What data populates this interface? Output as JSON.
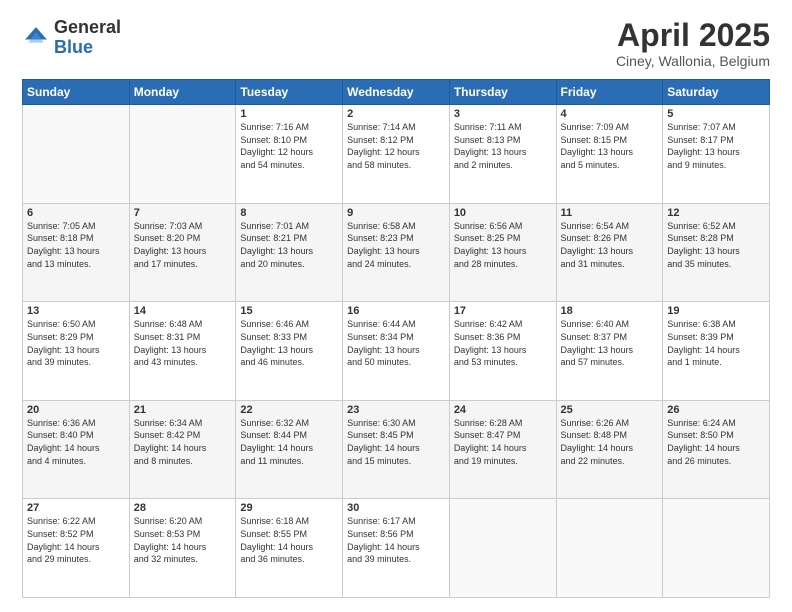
{
  "logo": {
    "general": "General",
    "blue": "Blue"
  },
  "header": {
    "title": "April 2025",
    "subtitle": "Ciney, Wallonia, Belgium"
  },
  "weekdays": [
    "Sunday",
    "Monday",
    "Tuesday",
    "Wednesday",
    "Thursday",
    "Friday",
    "Saturday"
  ],
  "weeks": [
    [
      {
        "day": "",
        "info": ""
      },
      {
        "day": "",
        "info": ""
      },
      {
        "day": "1",
        "info": "Sunrise: 7:16 AM\nSunset: 8:10 PM\nDaylight: 12 hours\nand 54 minutes."
      },
      {
        "day": "2",
        "info": "Sunrise: 7:14 AM\nSunset: 8:12 PM\nDaylight: 12 hours\nand 58 minutes."
      },
      {
        "day": "3",
        "info": "Sunrise: 7:11 AM\nSunset: 8:13 PM\nDaylight: 13 hours\nand 2 minutes."
      },
      {
        "day": "4",
        "info": "Sunrise: 7:09 AM\nSunset: 8:15 PM\nDaylight: 13 hours\nand 5 minutes."
      },
      {
        "day": "5",
        "info": "Sunrise: 7:07 AM\nSunset: 8:17 PM\nDaylight: 13 hours\nand 9 minutes."
      }
    ],
    [
      {
        "day": "6",
        "info": "Sunrise: 7:05 AM\nSunset: 8:18 PM\nDaylight: 13 hours\nand 13 minutes."
      },
      {
        "day": "7",
        "info": "Sunrise: 7:03 AM\nSunset: 8:20 PM\nDaylight: 13 hours\nand 17 minutes."
      },
      {
        "day": "8",
        "info": "Sunrise: 7:01 AM\nSunset: 8:21 PM\nDaylight: 13 hours\nand 20 minutes."
      },
      {
        "day": "9",
        "info": "Sunrise: 6:58 AM\nSunset: 8:23 PM\nDaylight: 13 hours\nand 24 minutes."
      },
      {
        "day": "10",
        "info": "Sunrise: 6:56 AM\nSunset: 8:25 PM\nDaylight: 13 hours\nand 28 minutes."
      },
      {
        "day": "11",
        "info": "Sunrise: 6:54 AM\nSunset: 8:26 PM\nDaylight: 13 hours\nand 31 minutes."
      },
      {
        "day": "12",
        "info": "Sunrise: 6:52 AM\nSunset: 8:28 PM\nDaylight: 13 hours\nand 35 minutes."
      }
    ],
    [
      {
        "day": "13",
        "info": "Sunrise: 6:50 AM\nSunset: 8:29 PM\nDaylight: 13 hours\nand 39 minutes."
      },
      {
        "day": "14",
        "info": "Sunrise: 6:48 AM\nSunset: 8:31 PM\nDaylight: 13 hours\nand 43 minutes."
      },
      {
        "day": "15",
        "info": "Sunrise: 6:46 AM\nSunset: 8:33 PM\nDaylight: 13 hours\nand 46 minutes."
      },
      {
        "day": "16",
        "info": "Sunrise: 6:44 AM\nSunset: 8:34 PM\nDaylight: 13 hours\nand 50 minutes."
      },
      {
        "day": "17",
        "info": "Sunrise: 6:42 AM\nSunset: 8:36 PM\nDaylight: 13 hours\nand 53 minutes."
      },
      {
        "day": "18",
        "info": "Sunrise: 6:40 AM\nSunset: 8:37 PM\nDaylight: 13 hours\nand 57 minutes."
      },
      {
        "day": "19",
        "info": "Sunrise: 6:38 AM\nSunset: 8:39 PM\nDaylight: 14 hours\nand 1 minute."
      }
    ],
    [
      {
        "day": "20",
        "info": "Sunrise: 6:36 AM\nSunset: 8:40 PM\nDaylight: 14 hours\nand 4 minutes."
      },
      {
        "day": "21",
        "info": "Sunrise: 6:34 AM\nSunset: 8:42 PM\nDaylight: 14 hours\nand 8 minutes."
      },
      {
        "day": "22",
        "info": "Sunrise: 6:32 AM\nSunset: 8:44 PM\nDaylight: 14 hours\nand 11 minutes."
      },
      {
        "day": "23",
        "info": "Sunrise: 6:30 AM\nSunset: 8:45 PM\nDaylight: 14 hours\nand 15 minutes."
      },
      {
        "day": "24",
        "info": "Sunrise: 6:28 AM\nSunset: 8:47 PM\nDaylight: 14 hours\nand 19 minutes."
      },
      {
        "day": "25",
        "info": "Sunrise: 6:26 AM\nSunset: 8:48 PM\nDaylight: 14 hours\nand 22 minutes."
      },
      {
        "day": "26",
        "info": "Sunrise: 6:24 AM\nSunset: 8:50 PM\nDaylight: 14 hours\nand 26 minutes."
      }
    ],
    [
      {
        "day": "27",
        "info": "Sunrise: 6:22 AM\nSunset: 8:52 PM\nDaylight: 14 hours\nand 29 minutes."
      },
      {
        "day": "28",
        "info": "Sunrise: 6:20 AM\nSunset: 8:53 PM\nDaylight: 14 hours\nand 32 minutes."
      },
      {
        "day": "29",
        "info": "Sunrise: 6:18 AM\nSunset: 8:55 PM\nDaylight: 14 hours\nand 36 minutes."
      },
      {
        "day": "30",
        "info": "Sunrise: 6:17 AM\nSunset: 8:56 PM\nDaylight: 14 hours\nand 39 minutes."
      },
      {
        "day": "",
        "info": ""
      },
      {
        "day": "",
        "info": ""
      },
      {
        "day": "",
        "info": ""
      }
    ]
  ]
}
